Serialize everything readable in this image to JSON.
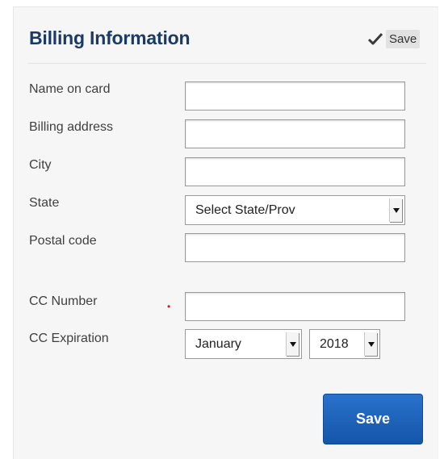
{
  "billing": {
    "title": "Billing Information",
    "header_save_label": "Save",
    "fields": {
      "name_on_card": {
        "label": "Name on card",
        "value": ""
      },
      "billing_address": {
        "label": "Billing address",
        "value": ""
      },
      "city": {
        "label": "City",
        "value": ""
      },
      "state": {
        "label": "State",
        "selected": "Select State/Prov"
      },
      "postal_code": {
        "label": "Postal code",
        "value": ""
      },
      "cc_number": {
        "label": "CC Number",
        "required_marker": "•",
        "value": ""
      },
      "cc_expiration": {
        "label": "CC Expiration",
        "month": "January",
        "year": "2018"
      }
    },
    "save_button_label": "Save"
  },
  "colors": {
    "title": "#1b3a66",
    "save_button": "#1a5fb8",
    "required_marker": "#cc2222",
    "panel_background": "#f6f6f6"
  },
  "icons": {
    "header_save": "checkmark-icon",
    "select_arrow": "chevron-down-icon"
  }
}
